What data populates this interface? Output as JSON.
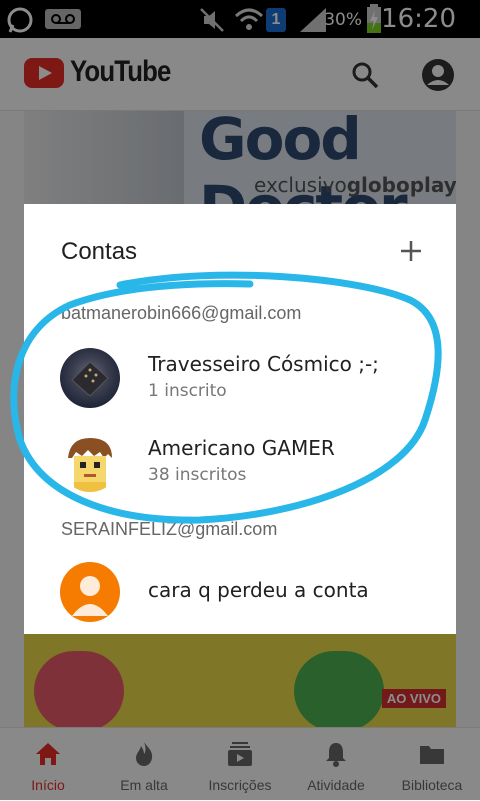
{
  "status_bar": {
    "battery_percent": "30%",
    "time": "16:20",
    "notification_badge": "1"
  },
  "app": {
    "logo_text": "YouTube"
  },
  "background": {
    "banner_title": "Good Doctor",
    "banner_subtitle_prefix": "exclusivo",
    "banner_subtitle_brand": "globoplay",
    "live_badge": "AO VIVO"
  },
  "dialog": {
    "title": "Contas",
    "groups": [
      {
        "email": "batmanerobin666@gmail.com",
        "accounts": [
          {
            "name": "Travesseiro Cósmico ;-;",
            "subscribers": "1 inscrito",
            "avatar": "dark-pillow-avatar"
          },
          {
            "name": "Americano GAMER",
            "subscribers": "38 inscritos",
            "avatar": "cartoon-boy-avatar"
          }
        ]
      },
      {
        "email": "SERAINFELIZ@gmail.com",
        "accounts": [
          {
            "name": "cara q perdeu a conta",
            "subscribers": "",
            "avatar": "default-person-avatar"
          }
        ]
      }
    ]
  },
  "annotation": {
    "color": "#29b6e8"
  },
  "nav": {
    "items": [
      {
        "label": "Início",
        "icon": "home-icon",
        "active": true
      },
      {
        "label": "Em alta",
        "icon": "flame-icon",
        "active": false
      },
      {
        "label": "Inscrições",
        "icon": "subscriptions-icon",
        "active": false
      },
      {
        "label": "Atividade",
        "icon": "bell-icon",
        "active": false
      },
      {
        "label": "Biblioteca",
        "icon": "folder-icon",
        "active": false
      }
    ]
  },
  "colors": {
    "accent": "#e52d27",
    "status_bar": "#000000",
    "dialog_bg": "#ffffff"
  }
}
